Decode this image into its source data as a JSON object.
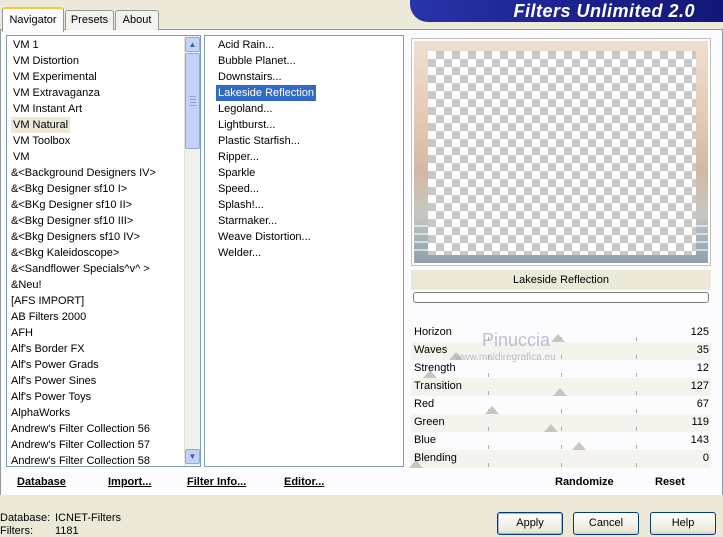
{
  "tabs": [
    {
      "label": "Navigator",
      "active": true
    },
    {
      "label": "Presets",
      "active": false
    },
    {
      "label": "About",
      "active": false
    }
  ],
  "banner": {
    "title": "Filters Unlimited 2.0"
  },
  "categories": [
    "VM 1",
    "VM Distortion",
    "VM Experimental",
    "VM Extravaganza",
    "VM Instant Art",
    "VM Natural",
    "VM Toolbox",
    "VM",
    "&<Background Designers IV>",
    "&<Bkg Designer sf10 I>",
    "&<BKg Designer sf10 II>",
    "&<Bkg Designer sf10 III>",
    "&<Bkg Designers sf10 IV>",
    "&<Bkg Kaleidoscope>",
    "&<Sandflower Specials^v^ >",
    "&Neu!",
    "[AFS IMPORT]",
    "AB Filters 2000",
    "AFH",
    "Alf's Border FX",
    "Alf's Power Grads",
    "Alf's Power Sines",
    "Alf's Power Toys",
    "AlphaWorks",
    "Andrew's Filter Collection 56",
    "Andrew's Filter Collection 57",
    "Andrew's Filter Collection 58"
  ],
  "selected_category": "VM Natural",
  "filters": [
    "Acid Rain...",
    "Bubble Planet...",
    "Downstairs...",
    "Lakeside Reflection",
    "Legoland...",
    "Lightburst...",
    "Plastic Starfish...",
    "Ripper...",
    "Sparkle",
    "Speed...",
    "Splash!...",
    "Starmaker...",
    "Weave Distortion...",
    "Welder..."
  ],
  "selected_filter": "Lakeside Reflection",
  "filter_name": "Lakeside Reflection",
  "params": [
    {
      "name": "Horizon",
      "value": "125"
    },
    {
      "name": "Waves",
      "value": "35"
    },
    {
      "name": "Strength",
      "value": "12"
    },
    {
      "name": "Transition",
      "value": "127"
    },
    {
      "name": "Red",
      "value": "67"
    },
    {
      "name": "Green",
      "value": "119"
    },
    {
      "name": "Blue",
      "value": "143"
    },
    {
      "name": "Blending",
      "value": "0"
    }
  ],
  "watermark": {
    "name": "Pinuccia",
    "url": "www.maidiregrafica.eu"
  },
  "bottom_links": {
    "database": "Database",
    "import": "Import...",
    "filter_info": "Filter Info...",
    "editor": "Editor...",
    "randomize": "Randomize",
    "reset": "Reset"
  },
  "footer": {
    "database_label": "Database:",
    "database_value": "ICNET-Filters",
    "filters_label": "Filters:",
    "filters_value": "1181",
    "apply": "Apply",
    "cancel": "Cancel",
    "help": "Help"
  },
  "colors": {
    "selection": "#316ac5",
    "banner": "#1a1f8a",
    "window": "#ece9d8"
  }
}
